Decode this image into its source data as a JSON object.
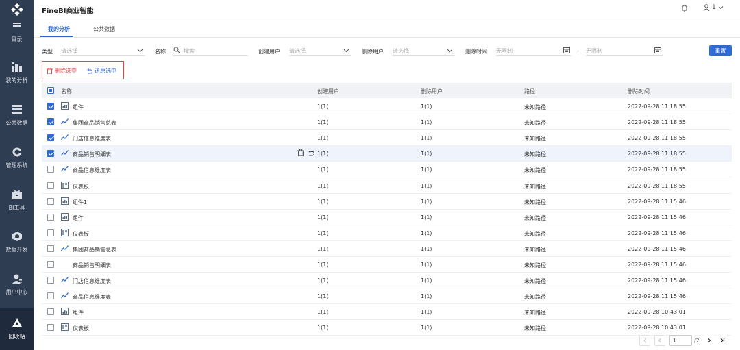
{
  "app": {
    "title": "FineBI商业智能",
    "user_label": "1"
  },
  "sidebar": {
    "items": [
      {
        "label": "目录",
        "icon": "catalog-icon"
      },
      {
        "label": "我的分析",
        "icon": "analysis-icon"
      },
      {
        "label": "公共数据",
        "icon": "public-data-icon"
      },
      {
        "label": "管理系统",
        "icon": "gear-icon"
      },
      {
        "label": "BI工具",
        "icon": "toolbox-icon"
      },
      {
        "label": "数据开发",
        "icon": "cube-icon"
      },
      {
        "label": "用户中心",
        "icon": "user-center-icon"
      },
      {
        "label": "回收站",
        "icon": "recycle-icon"
      }
    ]
  },
  "tabs": [
    {
      "label": "我的分析",
      "active": true
    },
    {
      "label": "公共数据",
      "active": false
    }
  ],
  "filters": {
    "type_label": "类型",
    "type_placeholder": "请选择",
    "name_label": "名称",
    "name_placeholder": "搜索",
    "creator_label": "创建用户",
    "creator_placeholder": "请选择",
    "deleter_label": "删除用户",
    "deleter_placeholder": "请选择",
    "time_label": "删除时间",
    "time_start_placeholder": "无限制",
    "time_end_placeholder": "无限制",
    "reset_label": "重置"
  },
  "actions": {
    "delete_selected": "删除选中",
    "restore_selected": "还原选中"
  },
  "table": {
    "columns": [
      "名称",
      "创建用户",
      "删除用户",
      "路径",
      "删除时间"
    ],
    "rows": [
      {
        "icon": "component-icon",
        "name": "组件",
        "creator": "1(1)",
        "deleter": "1(1)",
        "path": "未知路径",
        "time": "2022-09-28 11:18:55",
        "checked": true
      },
      {
        "icon": "line-chart-icon",
        "name": "集团商品销售总表",
        "creator": "1(1)",
        "deleter": "1(1)",
        "path": "未知路径",
        "time": "2022-09-28 11:18:55",
        "checked": true
      },
      {
        "icon": "line-chart-icon",
        "name": "门店信息维度表",
        "creator": "1(1)",
        "deleter": "1(1)",
        "path": "未知路径",
        "time": "2022-09-28 11:18:55",
        "checked": true
      },
      {
        "icon": "line-chart-icon",
        "name": "商品销售明细表",
        "creator": "1(1)",
        "deleter": "1(1)",
        "path": "未知路径",
        "time": "2022-09-28 11:18:55",
        "checked": true
      },
      {
        "icon": "line-chart-icon",
        "name": "商品信息维度表",
        "creator": "1(1)",
        "deleter": "1(1)",
        "path": "未知路径",
        "time": "2022-09-28 11:18:55",
        "checked": false
      },
      {
        "icon": "dashboard-icon",
        "name": "仪表板",
        "creator": "1(1)",
        "deleter": "1(1)",
        "path": "未知路径",
        "time": "2022-09-28 11:18:55",
        "checked": false
      },
      {
        "icon": "component-icon",
        "name": "组件1",
        "creator": "1(1)",
        "deleter": "1(1)",
        "path": "未知路径",
        "time": "2022-09-28 11:15:46",
        "checked": false
      },
      {
        "icon": "component-icon",
        "name": "组件",
        "creator": "1(1)",
        "deleter": "1(1)",
        "path": "未知路径",
        "time": "2022-09-28 11:15:46",
        "checked": false
      },
      {
        "icon": "dashboard-icon",
        "name": "仪表板",
        "creator": "1(1)",
        "deleter": "1(1)",
        "path": "未知路径",
        "time": "2022-09-28 11:15:46",
        "checked": false
      },
      {
        "icon": "line-chart-icon",
        "name": "集团商品销售总表",
        "creator": "1(1)",
        "deleter": "1(1)",
        "path": "未知路径",
        "time": "2022-09-28 11:15:46",
        "checked": false
      },
      {
        "icon": "none",
        "name": "商品销售明细表",
        "creator": "1(1)",
        "deleter": "1(1)",
        "path": "未知路径",
        "time": "2022-09-28 11:15:46",
        "checked": false
      },
      {
        "icon": "line-chart-icon",
        "name": "门店信息维度表",
        "creator": "1(1)",
        "deleter": "1(1)",
        "path": "未知路径",
        "time": "2022-09-28 11:15:46",
        "checked": false
      },
      {
        "icon": "line-chart-icon",
        "name": "商品信息维度表",
        "creator": "1(1)",
        "deleter": "1(1)",
        "path": "未知路径",
        "time": "2022-09-28 11:15:46",
        "checked": false
      },
      {
        "icon": "component-icon",
        "name": "组件",
        "creator": "1(1)",
        "deleter": "1(1)",
        "path": "未知路径",
        "time": "2022-09-28 10:43:01",
        "checked": false
      },
      {
        "icon": "dashboard-icon",
        "name": "仪表板",
        "creator": "1(1)",
        "deleter": "1(1)",
        "path": "未知路径",
        "time": "2022-09-28 10:43:01",
        "checked": false
      }
    ]
  },
  "pagination": {
    "current": "1",
    "total": "/2"
  }
}
